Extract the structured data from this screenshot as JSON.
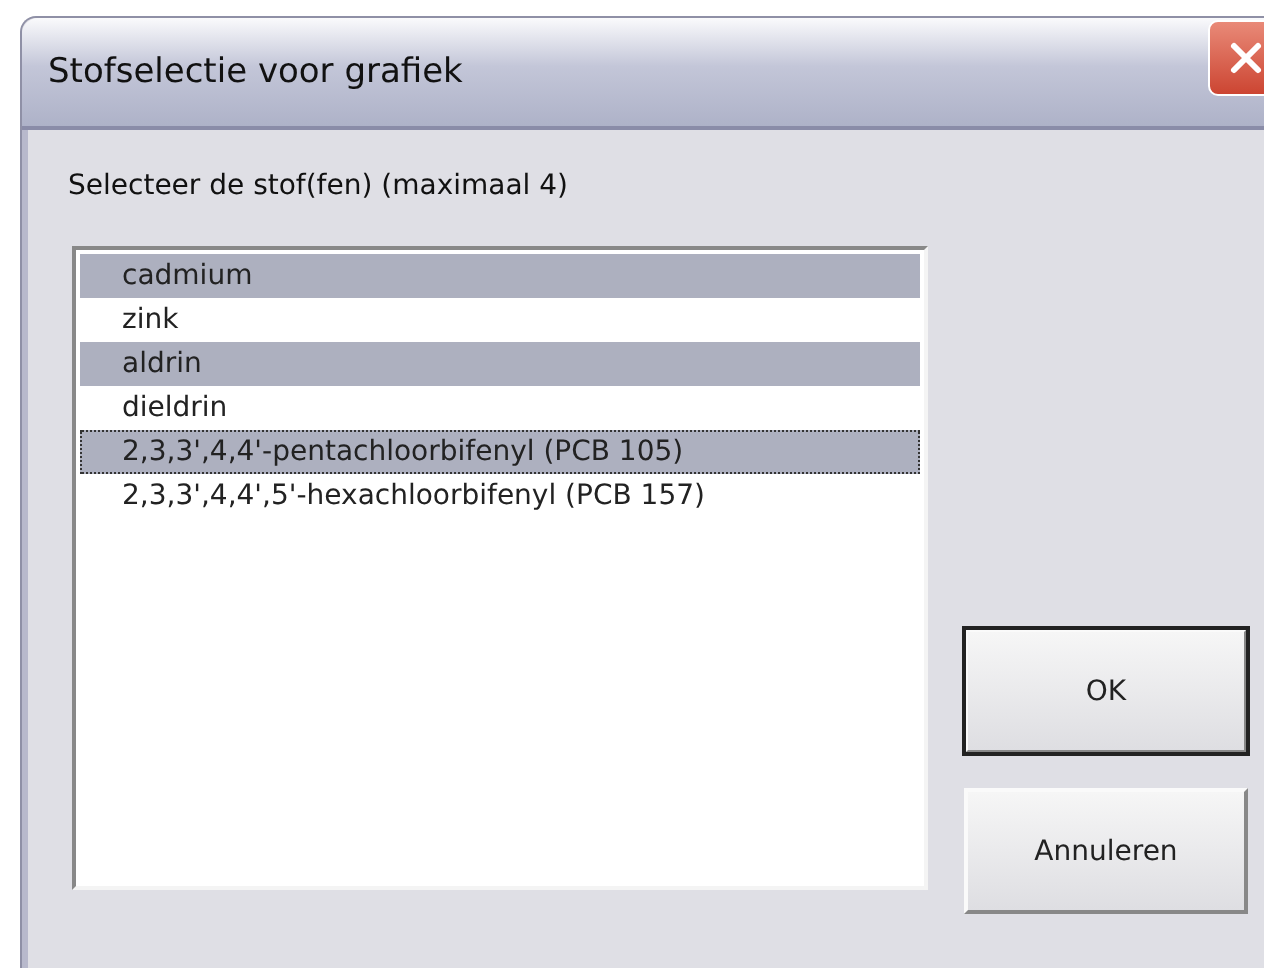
{
  "window": {
    "title": "Stofselectie voor grafiek"
  },
  "prompt": "Selecteer de stof(fen) (maximaal 4)",
  "list": {
    "items": [
      {
        "label": "cadmium",
        "selected": true,
        "focused": false
      },
      {
        "label": "zink",
        "selected": false,
        "focused": false
      },
      {
        "label": "aldrin",
        "selected": true,
        "focused": false
      },
      {
        "label": "dieldrin",
        "selected": false,
        "focused": false
      },
      {
        "label": "2,3,3',4,4'-pentachloorbifenyl (PCB 105)",
        "selected": true,
        "focused": true
      },
      {
        "label": "2,3,3',4,4',5'-hexachloorbifenyl (PCB 157)",
        "selected": false,
        "focused": false
      }
    ]
  },
  "buttons": [
    {
      "label": "OK",
      "default": true
    },
    {
      "label": "Annuleren",
      "default": false
    }
  ]
}
